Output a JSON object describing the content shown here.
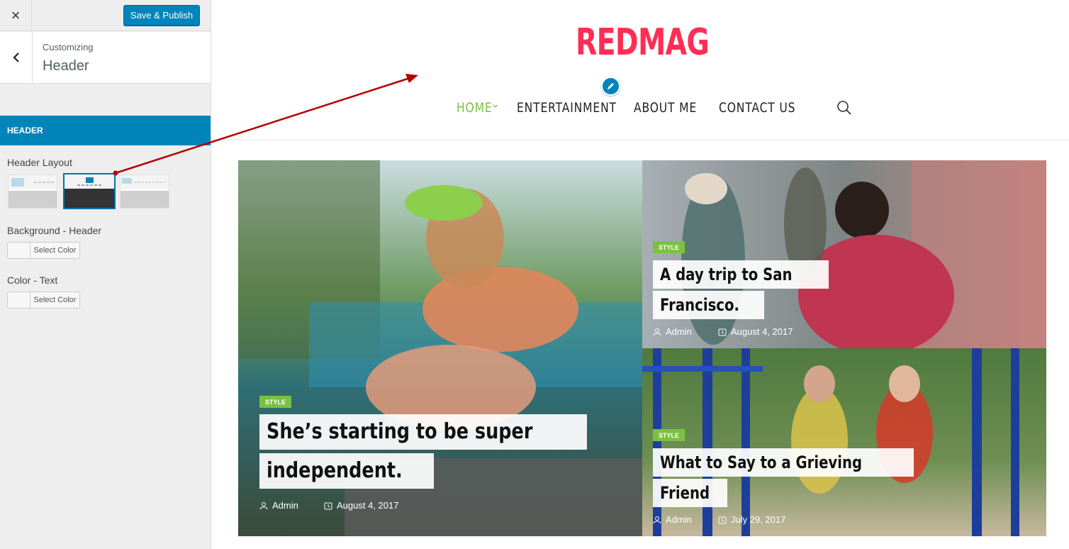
{
  "customizer": {
    "close_label": "×",
    "publish_label": "Save & Publish",
    "breadcrumb_small": "Customizing",
    "breadcrumb_title": "Header",
    "section_label": "HEADER",
    "header_layout_label": "Header Layout",
    "background_label": "Background - Header",
    "color_text_label": "Color - Text",
    "select_color_label": "Select Color",
    "accent_color": "#0085ba",
    "selected_layout": 2
  },
  "site": {
    "logo": "REDMAG",
    "logo_color": "#ff2d55",
    "nav": [
      {
        "label": "HOME",
        "active": true,
        "has_dropdown": true
      },
      {
        "label": "ENTERTAINMENT",
        "active": false
      },
      {
        "label": "ABOUT ME",
        "active": false
      },
      {
        "label": "CONTACT US",
        "active": false
      }
    ],
    "nav_active_color": "#7ac142",
    "posts": [
      {
        "category": "STYLE",
        "title_lines": [
          "She’s starting to be super",
          "independent."
        ],
        "author": "Admin",
        "date": "August 4, 2017"
      },
      {
        "category": "STYLE",
        "title_lines": [
          "A day trip to San",
          "Francisco."
        ],
        "author": "Admin",
        "date": "August 4, 2017"
      },
      {
        "category": "STYLE",
        "title_lines": [
          "What to Say to a Grieving",
          "Friend"
        ],
        "author": "Admin",
        "date": "July 29, 2017"
      }
    ]
  }
}
